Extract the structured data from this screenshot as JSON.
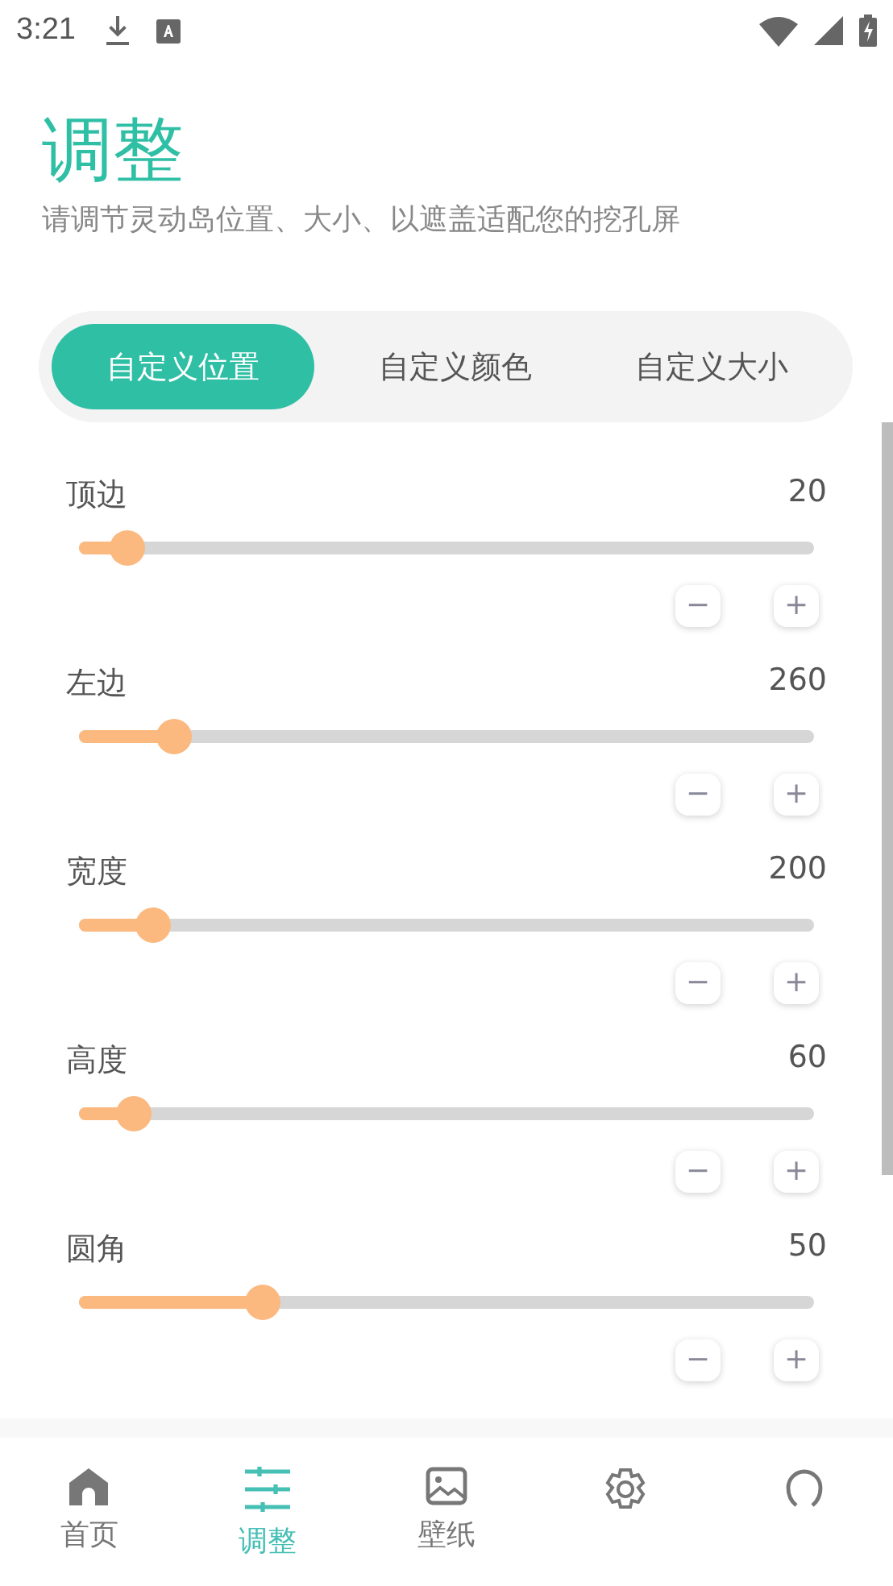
{
  "status_bar": {
    "time": "3:21"
  },
  "header": {
    "title": "调整",
    "subtitle": "请调节灵动岛位置、大小、以遮盖适配您的挖孔屏"
  },
  "tabs": [
    {
      "label": "自定义位置",
      "selected": true
    },
    {
      "label": "自定义颜色",
      "selected": false
    },
    {
      "label": "自定义大小",
      "selected": false
    }
  ],
  "sliders": [
    {
      "name": "顶边",
      "reading": "20",
      "level": 0.066,
      "minus": "−",
      "plus": "+"
    },
    {
      "name": "左边",
      "reading": "260",
      "level": 0.13,
      "minus": "−",
      "plus": "+"
    },
    {
      "name": "宽度",
      "reading": "200",
      "level": 0.1,
      "minus": "−",
      "plus": "+"
    },
    {
      "name": "高度",
      "reading": "60",
      "level": 0.075,
      "minus": "−",
      "plus": "+"
    },
    {
      "name": "圆角",
      "reading": "50",
      "level": 0.25,
      "minus": "−",
      "plus": "+"
    }
  ],
  "bottom_nav": [
    {
      "kind": "home",
      "label": "首页",
      "selected": false
    },
    {
      "kind": "sliders",
      "label": "调整",
      "selected": true
    },
    {
      "kind": "image",
      "label": "壁纸",
      "selected": false
    },
    {
      "kind": "gear",
      "selected": false
    },
    {
      "kind": "ring",
      "selected": false
    }
  ]
}
